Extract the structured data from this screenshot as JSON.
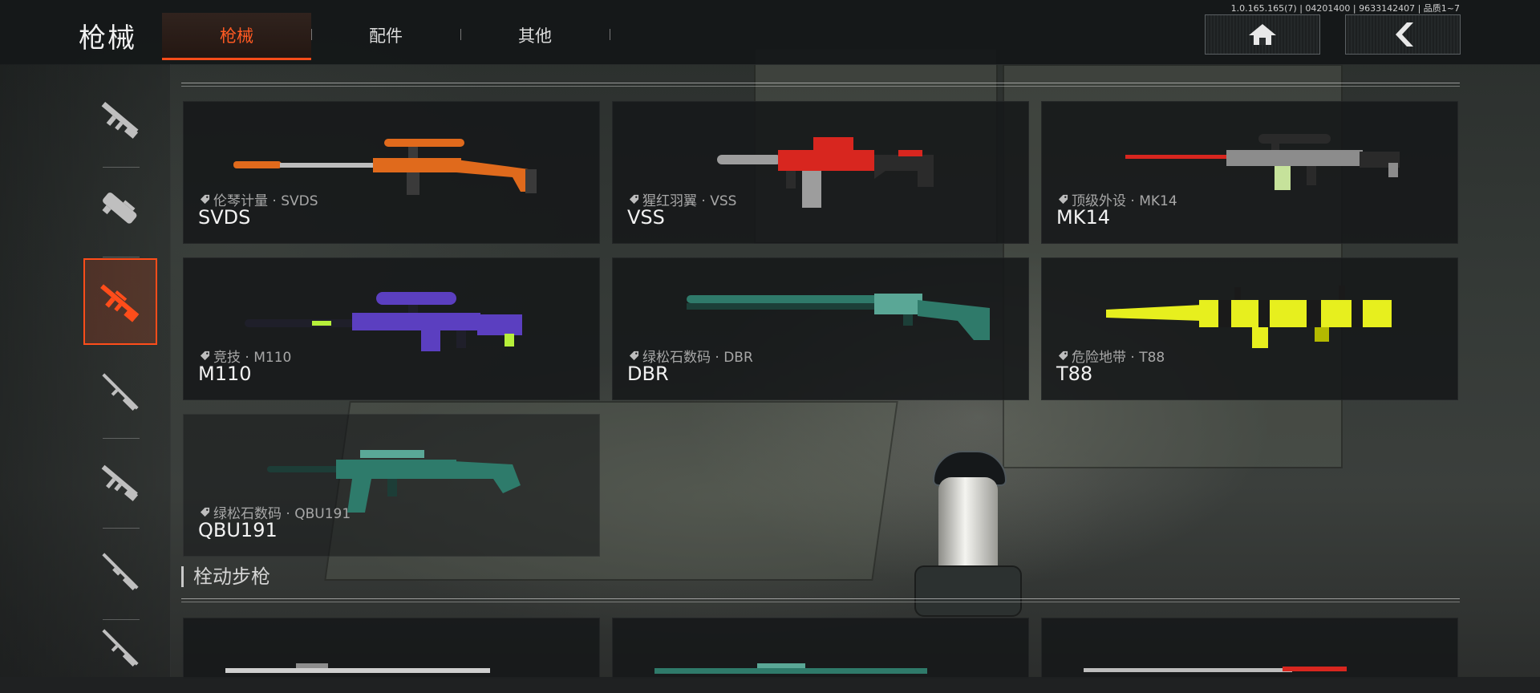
{
  "header": {
    "title": "枪械",
    "tabs": [
      {
        "label": "枪械",
        "active": true
      },
      {
        "label": "配件",
        "active": false
      },
      {
        "label": "其他",
        "active": false
      }
    ],
    "version": "1.0.165.165(7) | 04201400 | 9633142407 | 品质1~7",
    "home_icon": "home-icon",
    "back_icon": "back-chevron-icon"
  },
  "sidebar": {
    "items": [
      {
        "icon": "assault-rifle-icon",
        "active": false
      },
      {
        "icon": "smg-p90-icon",
        "active": false
      },
      {
        "icon": "marksman-rifle-icon",
        "active": true
      },
      {
        "icon": "sniper-rifle-icon",
        "active": false
      },
      {
        "icon": "rifle-icon",
        "active": false
      },
      {
        "icon": "shotgun-icon",
        "active": false
      },
      {
        "icon": "pistol-rifle-icon",
        "active": false
      }
    ]
  },
  "weapons": [
    {
      "skin": "伦琴计量 · SVDS",
      "name": "SVDS",
      "colors": [
        "#e06a1c",
        "#3a3a3a",
        "#bdbdbd"
      ]
    },
    {
      "skin": "猩红羽翼 · VSS",
      "name": "VSS",
      "colors": [
        "#d8261f",
        "#2b2b2b",
        "#9d9d9d"
      ]
    },
    {
      "skin": "顶级外设 · MK14",
      "name": "MK14",
      "colors": [
        "#8c8c8c",
        "#2a2a2a",
        "#c6e29b"
      ]
    },
    {
      "skin": "竞技 · M110",
      "name": "M110",
      "colors": [
        "#5b3fc0",
        "#1f1f2a",
        "#b6ef3a"
      ]
    },
    {
      "skin": "绿松石数码 · DBR",
      "name": "DBR",
      "colors": [
        "#2f7a6a",
        "#1c3f38",
        "#5aa796"
      ]
    },
    {
      "skin": "危险地带 · T88",
      "name": "T88",
      "colors": [
        "#e7ef1e",
        "#1a1a1a",
        "#b4b900"
      ]
    },
    {
      "skin": "绿松石数码 · QBU191",
      "name": "QBU191",
      "colors": [
        "#2e7b6b",
        "#1d3d37",
        "#5aa897"
      ]
    }
  ],
  "section": {
    "title": "栓动步枪"
  },
  "colors": {
    "accent": "#ff4d1a",
    "card_bg": "#161819"
  }
}
